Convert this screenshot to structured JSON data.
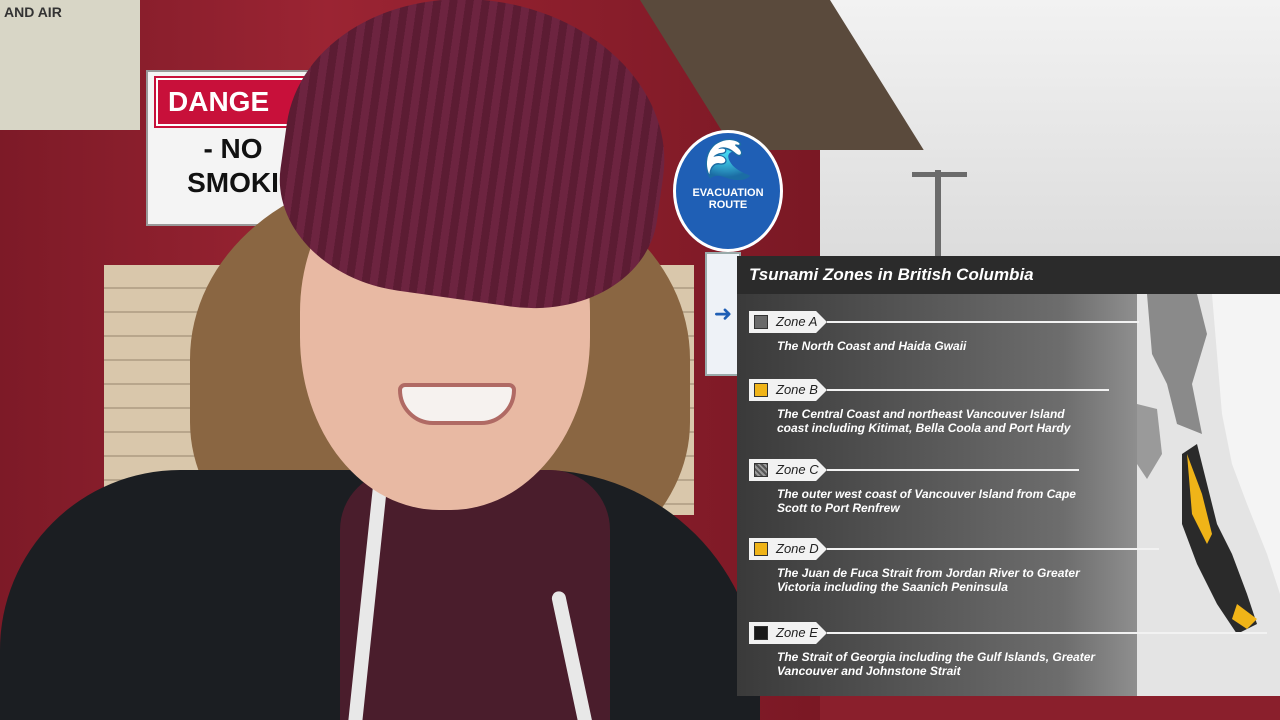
{
  "scene": {
    "air_sign": "AND AIR",
    "danger_sign": {
      "header": "DANGE",
      "line1": "- NO",
      "line2": "SMOKI"
    },
    "evacuation_sign": "EVACUATION ROUTE",
    "arrow_sign": "➜"
  },
  "overlay": {
    "title": "Tsunami Zones in British Columbia",
    "zones": [
      {
        "label": "Zone A",
        "swatch": "#6a6a6a",
        "description": "The North Coast and Haida Gwaii"
      },
      {
        "label": "Zone B",
        "swatch": "#f0b418",
        "description": "The Central Coast and northeast Vancouver Island coast including Kitimat, Bella Coola and Port Hardy"
      },
      {
        "label": "Zone C",
        "swatch": "#7a7a7a",
        "description": "The outer west coast of Vancouver Island from Cape Scott to Port Renfrew"
      },
      {
        "label": "Zone D",
        "swatch": "#f0b418",
        "description": "The Juan de Fuca Strait from Jordan River to Greater Victoria including the Saanich Peninsula"
      },
      {
        "label": "Zone E",
        "swatch": "#1a1a1a",
        "description": "The Strait of Georgia including the Gulf Islands, Greater Vancouver and Johnstone Strait"
      }
    ]
  }
}
